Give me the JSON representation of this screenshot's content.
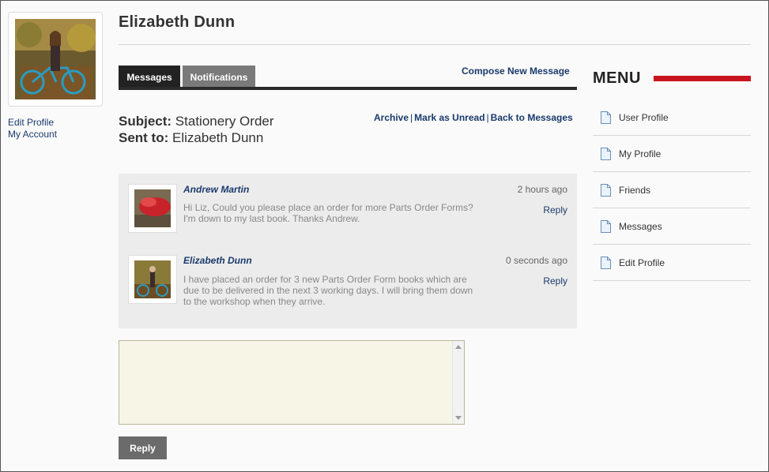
{
  "user": {
    "name": "Elizabeth Dunn",
    "links": [
      "Edit Profile",
      "My Account"
    ]
  },
  "tabs": [
    {
      "label": "Messages",
      "active": true
    },
    {
      "label": "Notifications",
      "active": false
    }
  ],
  "compose_label": "Compose New Message",
  "conversation": {
    "subject_label": "Subject:",
    "subject": "Stationery Order",
    "sent_to_label": "Sent to:",
    "sent_to": "Elizabeth Dunn",
    "actions": [
      "Archive",
      "Mark as Unread",
      "Back to Messages"
    ],
    "messages": [
      {
        "author": "Andrew Martin",
        "time": "2 hours ago",
        "text": "Hi Liz, Could you please place an order for more Parts Order Forms? I'm down to my last book. Thanks Andrew.",
        "reply_label": "Reply"
      },
      {
        "author": "Elizabeth Dunn",
        "time": "0 seconds ago",
        "text": "I have placed an order for 3 new Parts Order Form books which are due to be delivered in the next 3 working days. I will bring them down to the workshop when they arrive.",
        "reply_label": "Reply"
      }
    ]
  },
  "reply_box": {
    "value": "",
    "button_label": "Reply"
  },
  "menu": {
    "title": "MENU",
    "accent_color": "#c8141e",
    "items": [
      "User Profile",
      "My Profile",
      "Friends",
      "Messages",
      "Edit Profile"
    ],
    "item_icon": "document-icon"
  }
}
